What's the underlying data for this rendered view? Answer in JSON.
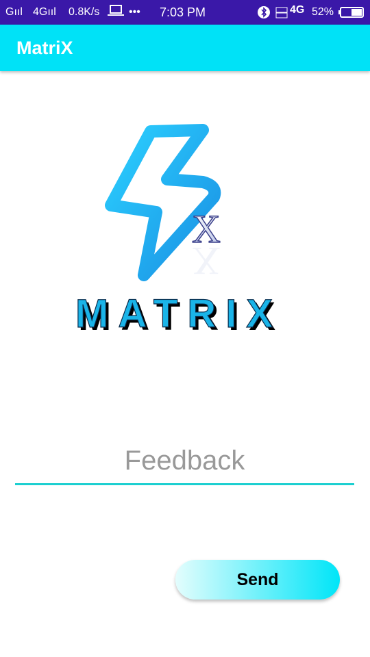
{
  "status_bar": {
    "signal_1": "Gııl",
    "signal_2": "4Gııl",
    "speed": "0.8K/s",
    "more": "•••",
    "time": "7:03 PM",
    "network": "4G",
    "battery": "52%",
    "icons": [
      "laptop-icon",
      "bluetooth-icon",
      "volte-icon",
      "battery-icon"
    ]
  },
  "app_bar": {
    "title": "MatriX",
    "color": "#00e2f7"
  },
  "logo": {
    "wordmark": "MATRIX",
    "badge": "X",
    "color": "#1ab4e8"
  },
  "feedback": {
    "placeholder": "Feedback",
    "value": ""
  },
  "send": {
    "label": "Send"
  }
}
